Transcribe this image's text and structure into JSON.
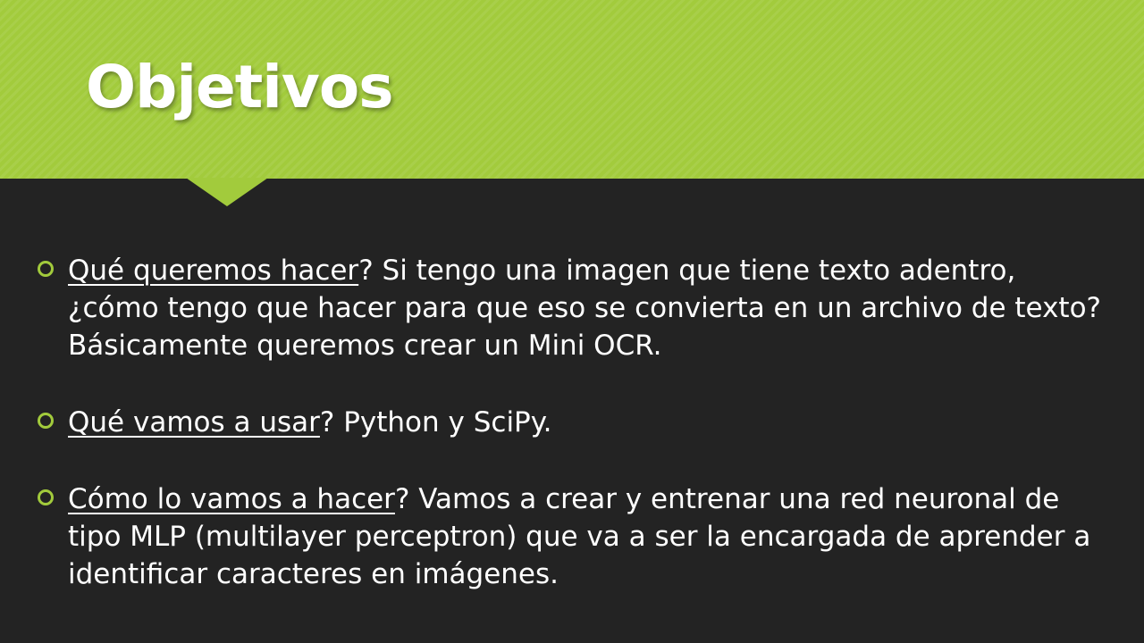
{
  "slide": {
    "title": "Objetivos",
    "accent_color": "#a2cb3c",
    "background_color": "#232323"
  },
  "bullets": [
    {
      "marker_icon": "hollow-circle-bullet",
      "lead": "Qué queremos hacer",
      "lead_suffix": "?",
      "text": " Si tengo una imagen que tiene texto adentro, ¿cómo tengo que hacer para que eso se convierta en un archivo de texto? Básicamente queremos crear un Mini OCR."
    },
    {
      "marker_icon": "hollow-circle-bullet",
      "lead": "Qué vamos a usar",
      "lead_suffix": "?",
      "text": " Python y SciPy."
    },
    {
      "marker_icon": "hollow-circle-bullet",
      "lead": "Cómo lo vamos a hacer",
      "lead_suffix": "?",
      "text": " Vamos a crear y entrenar una red neuronal de tipo MLP (multilayer perceptron) que va a ser la encargada de aprender a identificar caracteres en imágenes."
    }
  ]
}
